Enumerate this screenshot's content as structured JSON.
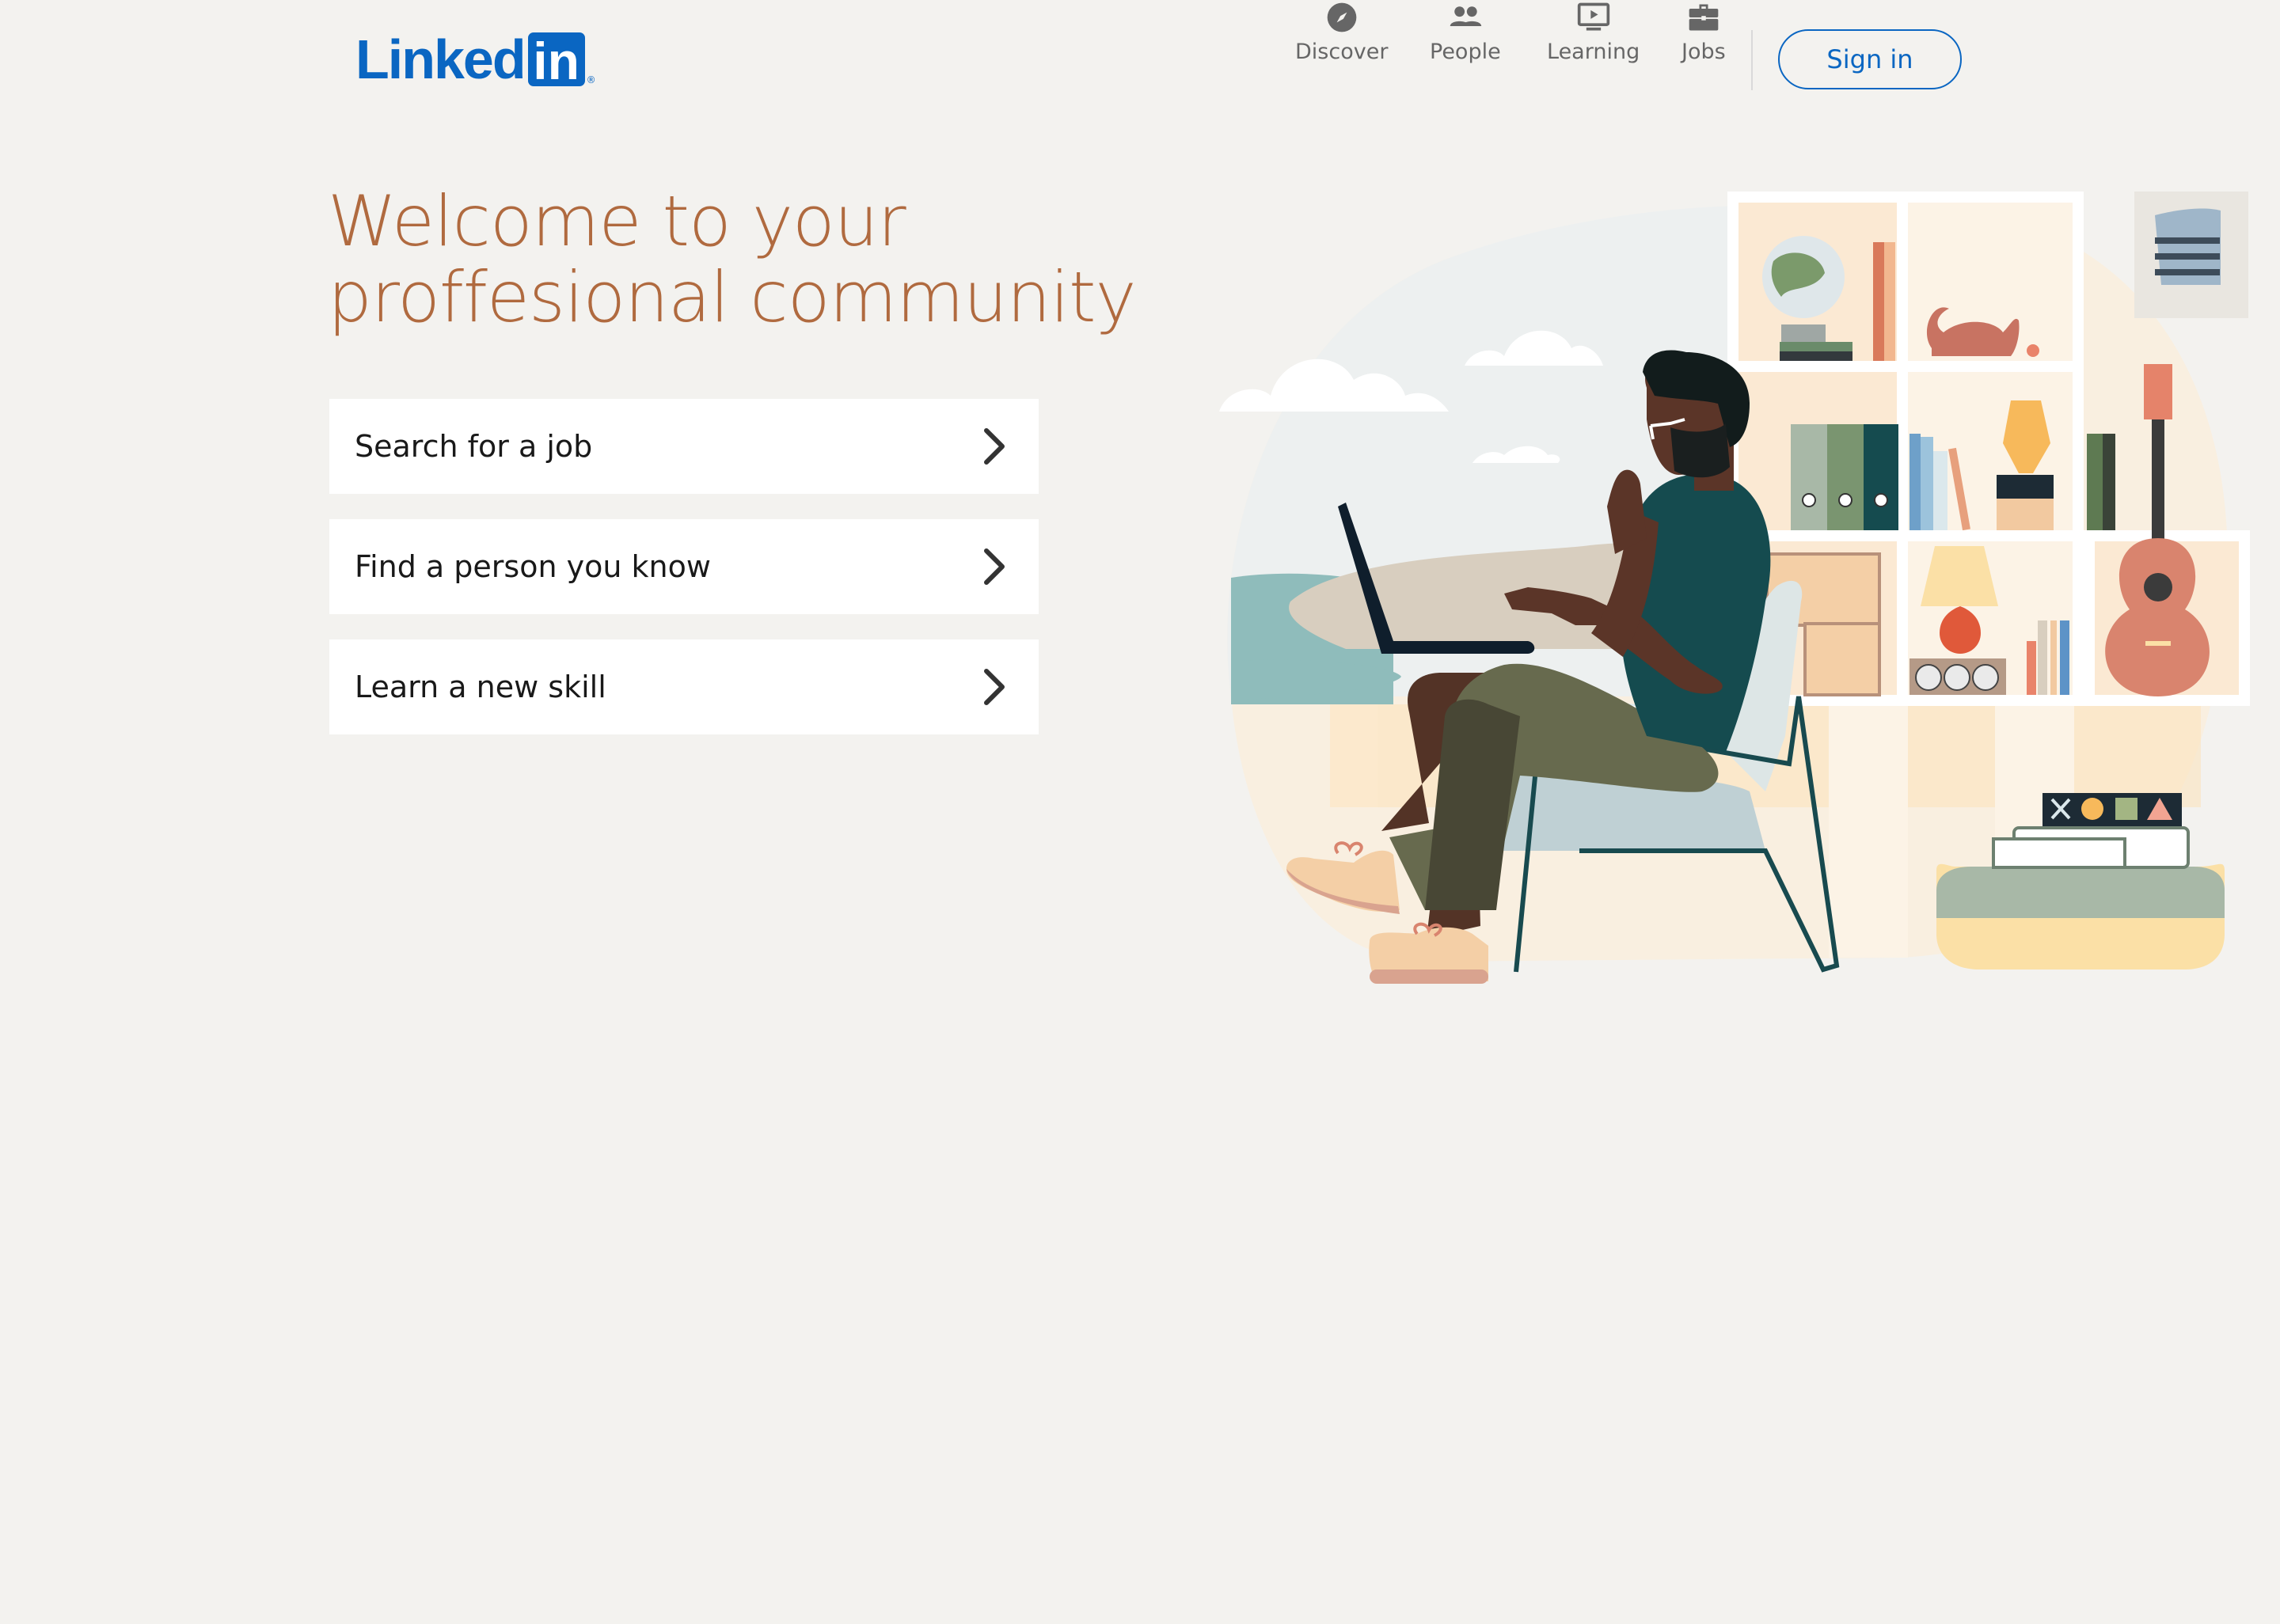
{
  "header": {
    "logo_word": "Linked",
    "logo_box": "in",
    "logo_reg": "®",
    "nav": [
      {
        "label": "Discover",
        "icon": "compass-icon"
      },
      {
        "label": "People",
        "icon": "people-icon"
      },
      {
        "label": "Learning",
        "icon": "play-video-icon"
      },
      {
        "label": "Jobs",
        "icon": "briefcase-icon"
      }
    ],
    "signin_label": "Sign in"
  },
  "hero": {
    "title_line1": "Welcome to your",
    "title_line2": "proffesional community",
    "options": [
      {
        "label": "Search for a job"
      },
      {
        "label": "Find a person you know"
      },
      {
        "label": "Learn a new skill"
      }
    ]
  },
  "colors": {
    "brand": "#0a66c2",
    "title": "#b06a3f",
    "background": "#f3f2ef"
  }
}
